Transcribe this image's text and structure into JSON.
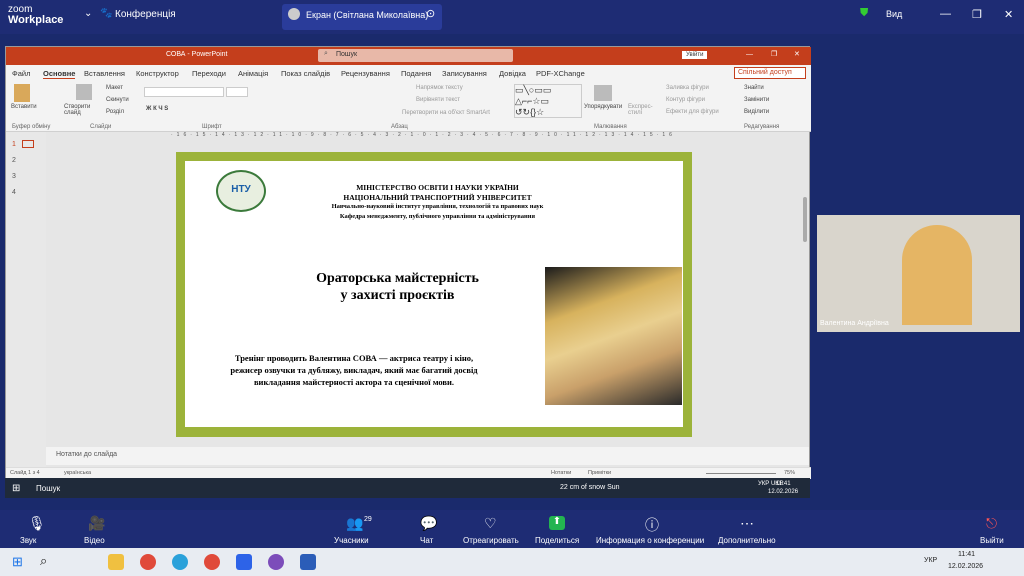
{
  "zoom": {
    "logo_top": "zoom",
    "logo_bottom": "Workplace",
    "conference": "Конференція",
    "share_title": "Екран (Світлана Миколаївна)",
    "view": "Вид"
  },
  "ppt": {
    "title": "СОВА - PowerPoint",
    "search": "Пошук",
    "signin": "Увійти",
    "share": "Спільний доступ",
    "tabs": [
      "Файл",
      "Основне",
      "Вставлення",
      "Конструктор",
      "Переходи",
      "Анімація",
      "Показ слайдів",
      "Рецензування",
      "Подання",
      "Записування",
      "Довідка",
      "PDF-XChange"
    ],
    "groups": [
      "Буфер обміну",
      "Слайди",
      "Шрифт",
      "Абзац",
      "Малювання",
      "Редагування"
    ],
    "ribbon": {
      "paste": "Вставити",
      "new_slide": "Створити слайд",
      "layout": "Макет",
      "reset": "Скинути",
      "section": "Розділ",
      "arrange": "Упорядкувати",
      "styles": "Експрес-стилі",
      "find": "Знайти",
      "replace": "Замінити",
      "select": "Виділити",
      "fill": "Заливка фігури",
      "outline": "Контур фігури",
      "effects": "Ефекти для фігури",
      "direction": "Напрямок тексту",
      "align": "Вирівняти текст",
      "smartart": "Перетворити на об'єкт SmartArt"
    },
    "slide_nums": [
      "1",
      "2",
      "3",
      "4"
    ],
    "notes": "Нотатки до слайда",
    "status": {
      "slide": "Слайд 1 з 4",
      "lang": "українська",
      "notes": "Нотатки",
      "comments": "Примітки",
      "zoom": "75%"
    }
  },
  "slide": {
    "line1": "МІНІСТЕРСТВО ОСВІТИ І НАУКИ УКРАЇНИ",
    "line2": "НАЦІОНАЛЬНИЙ ТРАНСПОРТНИЙ УНІВЕРСИТЕТ",
    "line3": "Навчально-науковий інститут управління, технологій та правових наук",
    "line4": "Кафедра менеджменту, публічного управління та адміністрування",
    "title1": "Ораторська майстерність",
    "title2": "у захисті проєктів",
    "body": "Тренінг проводить Валентина СОВА — актриса театру і кіно, режисер озвучки та дубляжу, викладач, який має багатий досвід викладання майстерності актора та сценічної мови.",
    "logo": "НТУ"
  },
  "taskbar_inner": {
    "search": "Пошук",
    "weather": "22 cm of snow Sun",
    "lang": "УКР\nUKR",
    "time": "11:41",
    "date": "12.02.2026"
  },
  "participant": {
    "name": "Валентина Андріївна"
  },
  "controls": [
    {
      "label": "Звук",
      "icon": "🎙"
    },
    {
      "label": "Відео",
      "icon": "🎥"
    },
    {
      "label": "Учасники",
      "icon": "👥",
      "count": "29"
    },
    {
      "label": "Чат",
      "icon": "💬"
    },
    {
      "label": "Отреагировать",
      "icon": "♡"
    },
    {
      "label": "Поделиться",
      "icon": "⬆"
    },
    {
      "label": "Информация о конференции",
      "icon": "ⓘ"
    },
    {
      "label": "Дополнительно",
      "icon": "⋯"
    },
    {
      "label": "Выйти",
      "icon": "⎋"
    }
  ],
  "taskbar": {
    "lang": "УКР",
    "time": "11:41",
    "date": "12.02.2026"
  },
  "colors": {
    "zoom": "#1e2c74",
    "ppt": "#c43e1c",
    "slide_border": "#9cb33a"
  }
}
